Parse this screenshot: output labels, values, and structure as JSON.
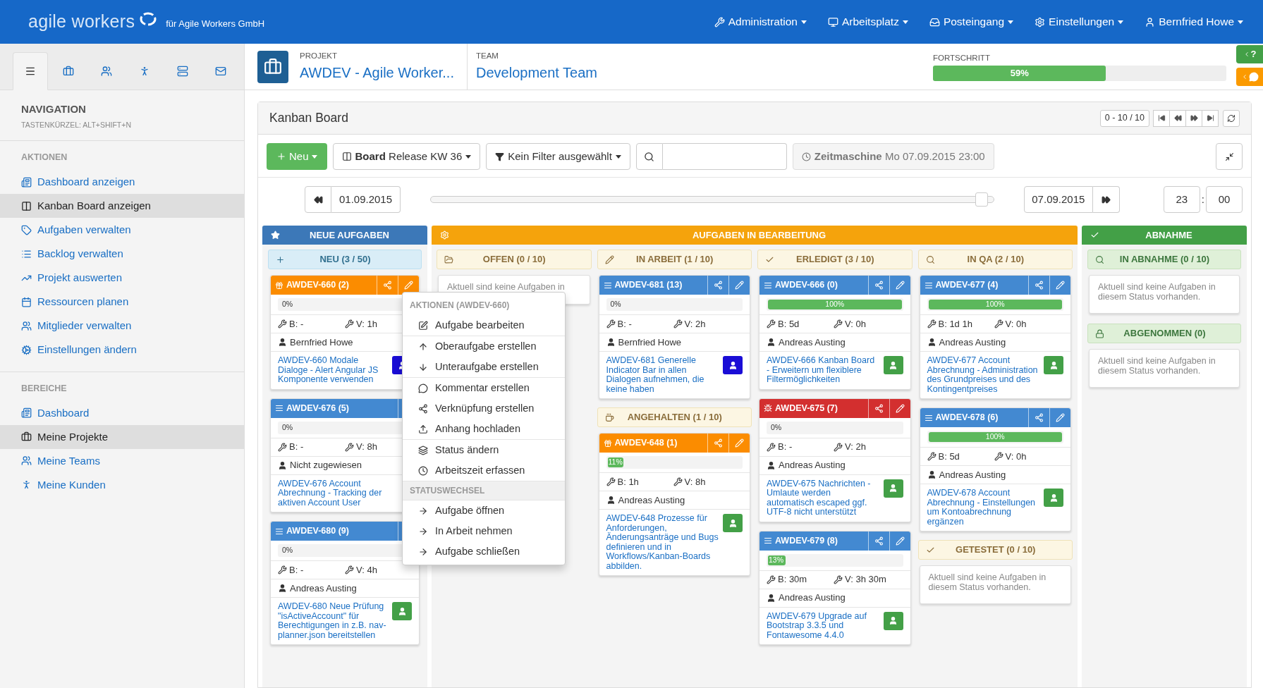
{
  "top_bar": {
    "logo": "agile workers",
    "company": "für Agile Workers GmbH",
    "menus": [
      {
        "label": "Administration"
      },
      {
        "label": "Arbeitsplatz"
      },
      {
        "label": "Posteingang"
      },
      {
        "label": "Einstellungen"
      },
      {
        "label": "Bernfried Howe"
      }
    ]
  },
  "sidebar": {
    "tabs": [
      {
        "selected": true
      },
      {
        "selected": false
      },
      {
        "selected": false
      },
      {
        "selected": false
      },
      {
        "selected": false
      },
      {
        "selected": false
      }
    ],
    "title": "NAVIGATION",
    "shortcut": "TASTENKÜRZEL: ALT+SHIFT+N",
    "sections": [
      {
        "title": "AKTIONEN",
        "items": [
          {
            "label": "Dashboard anzeigen",
            "selected": false
          },
          {
            "label": "Kanban Board anzeigen",
            "selected": true
          },
          {
            "label": "Aufgaben verwalten",
            "selected": false
          },
          {
            "label": "Backlog verwalten",
            "selected": false
          },
          {
            "label": "Projekt auswerten",
            "selected": false
          },
          {
            "label": "Ressourcen planen",
            "selected": false
          },
          {
            "label": "Mitglieder verwalten",
            "selected": false
          },
          {
            "label": "Einstellungen ändern",
            "selected": false
          }
        ]
      },
      {
        "title": "BEREICHE",
        "items": [
          {
            "label": "Dashboard",
            "selected": false
          },
          {
            "label": "Meine Projekte",
            "selected": true
          },
          {
            "label": "Meine Teams",
            "selected": false
          },
          {
            "label": "Meine Kunden",
            "selected": false
          }
        ]
      }
    ]
  },
  "header": {
    "project": {
      "label": "PROJEKT",
      "value": "AWDEV - Agile Worker..."
    },
    "team": {
      "label": "TEAM",
      "value": "Development Team"
    },
    "progress": {
      "label": "FORTSCHRITT",
      "level": 0.59,
      "text": "59%"
    },
    "side_tabs": [
      {
        "kind": "help",
        "label": "?"
      },
      {
        "kind": "chat"
      }
    ]
  },
  "board": {
    "title": "Kanban Board",
    "pager": "0 - 10 / 10",
    "new_button": "Neu",
    "board_select": "**Board** Release KW 36",
    "filter": "Kein Filter ausgewählt",
    "time_machine": "**Zeitmaschine** Mo 07.09.2015 23:00",
    "timeline": {
      "start": "01.09.2015",
      "end": "07.09.2015",
      "level": 0.99,
      "hour": "23",
      "separator": ":",
      "minute": "00"
    }
  },
  "groups": [
    {
      "kind": "new",
      "title": "NEUE AUFGABEN",
      "columns": [
        {
          "lanes": [
            {
              "kind": "new",
              "title": "NEU (3 / 50)",
              "cards": [
                {
                  "kind": "feature",
                  "id": "AWDEV-660 (2)",
                  "edit": true,
                  "level": 0,
                  "percent": "0%",
                  "b": "B: -",
                  "v": "V: 1h",
                  "assignee": "Bernfried Howe",
                  "title": "AWDEV-660 Modale Dialoge - Alert Angular JS Komponente verwenden",
                  "color": "#1a0dd6"
                },
                {
                  "kind": "story",
                  "id": "AWDEV-676 (5)",
                  "edit": false,
                  "level": 0,
                  "percent": "0%",
                  "b": "B: -",
                  "v": "V: 8h",
                  "assignee": "Nicht zugewiesen",
                  "title": "AWDEV-676 Account Abrechnung - Tracking der aktiven Account User"
                },
                {
                  "kind": "story",
                  "id": "AWDEV-680 (9)",
                  "edit": false,
                  "level": 0,
                  "percent": "0%",
                  "b": "B: -",
                  "v": "V: 4h",
                  "assignee": "Andreas Austing",
                  "title": "AWDEV-680 Neue Prüfung \"isActiveAccount\" für Berechtigungen in z.B. nav-planner.json bereitstellen",
                  "color": "#43a047"
                }
              ]
            }
          ]
        }
      ]
    },
    {
      "kind": "progress",
      "title": "AUFGABEN IN BEARBEITUNG",
      "columns": [
        {
          "lanes": [
            {
              "kind": "open",
              "title": "OFFEN (0 / 10)",
              "empty": "Aktuell sind keine Aufgaben in"
            }
          ]
        },
        {
          "lanes": [
            {
              "kind": "working",
              "title": "IN ARBEIT (1 / 10)",
              "cards": [
                {
                  "kind": "story",
                  "id": "AWDEV-681 (13)",
                  "edit": true,
                  "level": 0,
                  "percent": "0%",
                  "b": "B: -",
                  "v": "V: 2h",
                  "assignee": "Bernfried Howe",
                  "title": "AWDEV-681 Generelle Indicator Bar in allen Dialogen aufnehmen, die keine haben",
                  "color": "#1a0dd6"
                }
              ]
            },
            {
              "kind": "paused",
              "title": "ANGEHALTEN (1 / 10)",
              "cards": [
                {
                  "kind": "feature",
                  "id": "AWDEV-648 (1)",
                  "edit": true,
                  "level": 0.11,
                  "percent": "11%",
                  "b": "B: 1h",
                  "v": "V: 8h",
                  "assignee": "Andreas Austing",
                  "title": "AWDEV-648 Prozesse für Anforderungen, Änderungsanträge und Bugs definieren und in Workflows/Kanban-Boards abbilden.",
                  "color": "#43a047"
                }
              ]
            }
          ]
        },
        {
          "lanes": [
            {
              "kind": "done",
              "title": "ERLEDIGT (3 / 10)",
              "cards": [
                {
                  "kind": "story",
                  "id": "AWDEV-666 (0)",
                  "edit": true,
                  "level": 1,
                  "percent": "100%",
                  "b": "B: 5d",
                  "v": "V: 0h",
                  "assignee": "Andreas Austing",
                  "title": "AWDEV-666 Kanban Board - Erweitern um flexiblere Filtermöglichkeiten",
                  "color": "#43a047"
                },
                {
                  "kind": "bug",
                  "id": "AWDEV-675 (7)",
                  "edit": true,
                  "level": 0,
                  "percent": "0%",
                  "b": "B: -",
                  "v": "V: 2h",
                  "assignee": "Andreas Austing",
                  "title": "AWDEV-675 Nachrichten - Umlaute werden automatisch escaped ggf. UTF-8 nicht unterstützt",
                  "color": "#43a047"
                },
                {
                  "kind": "story",
                  "id": "AWDEV-679 (8)",
                  "edit": true,
                  "level": 0.13,
                  "percent": "13%",
                  "b": "B: 30m",
                  "v": "V: 3h 30m",
                  "assignee": "Andreas Austing",
                  "title": "AWDEV-679 Upgrade auf Bootstrap 3.3.5 und Fontawesome 4.4.0",
                  "color": "#43a047"
                }
              ]
            }
          ]
        },
        {
          "lanes": [
            {
              "kind": "qa",
              "title": "IN QA (2 / 10)",
              "cards": [
                {
                  "kind": "story",
                  "id": "AWDEV-677 (4)",
                  "edit": true,
                  "level": 1,
                  "percent": "100%",
                  "b": "B: 1d 1h",
                  "v": "V: 0h",
                  "assignee": "Andreas Austing",
                  "title": "AWDEV-677 Account Abrechnung - Administration des Grundpreises und des Kontingentpreises",
                  "color": "#43a047"
                },
                {
                  "kind": "story",
                  "id": "AWDEV-678 (6)",
                  "edit": true,
                  "level": 1,
                  "percent": "100%",
                  "b": "B: 5d",
                  "v": "V: 0h",
                  "assignee": "Andreas Austing",
                  "title": "AWDEV-678 Account Abrechnung - Einstellungen um Kontoabrechnung ergänzen",
                  "color": "#43a047"
                }
              ]
            },
            {
              "kind": "tested",
              "title": "GETESTET (0 / 10)",
              "empty": "Aktuell sind keine Aufgaben in diesem Status vorhanden."
            }
          ]
        }
      ]
    },
    {
      "kind": "accept",
      "title": "ABNAHME",
      "columns": [
        {
          "lanes": [
            {
              "kind": "review",
              "title": "IN ABNAHME (0 / 10)",
              "empty": "Aktuell sind keine Aufgaben in diesem Status vorhanden."
            },
            {
              "kind": "accepted",
              "title": "ABGENOMMEN (0)",
              "empty": "Aktuell sind keine Aufgaben in diesem Status vorhanden."
            }
          ]
        }
      ]
    }
  ],
  "context_menu": {
    "groups": [
      {
        "header": "AKTIONEN (AWDEV-660)",
        "items": [
          "Aufgabe bearbeiten"
        ]
      },
      {
        "items": [
          "Oberaufgabe erstellen",
          "Unteraufgabe erstellen"
        ]
      },
      {
        "items": [
          "Kommentar erstellen",
          "Verknüpfung erstellen",
          "Anhang hochladen"
        ]
      },
      {
        "items": [
          "Status ändern",
          "Arbeitszeit erfassen"
        ]
      },
      {
        "header": "STATUSWECHSEL",
        "items": [
          "Aufgabe öffnen",
          "In Arbeit nehmen",
          "Aufgabe schließen"
        ]
      }
    ]
  }
}
